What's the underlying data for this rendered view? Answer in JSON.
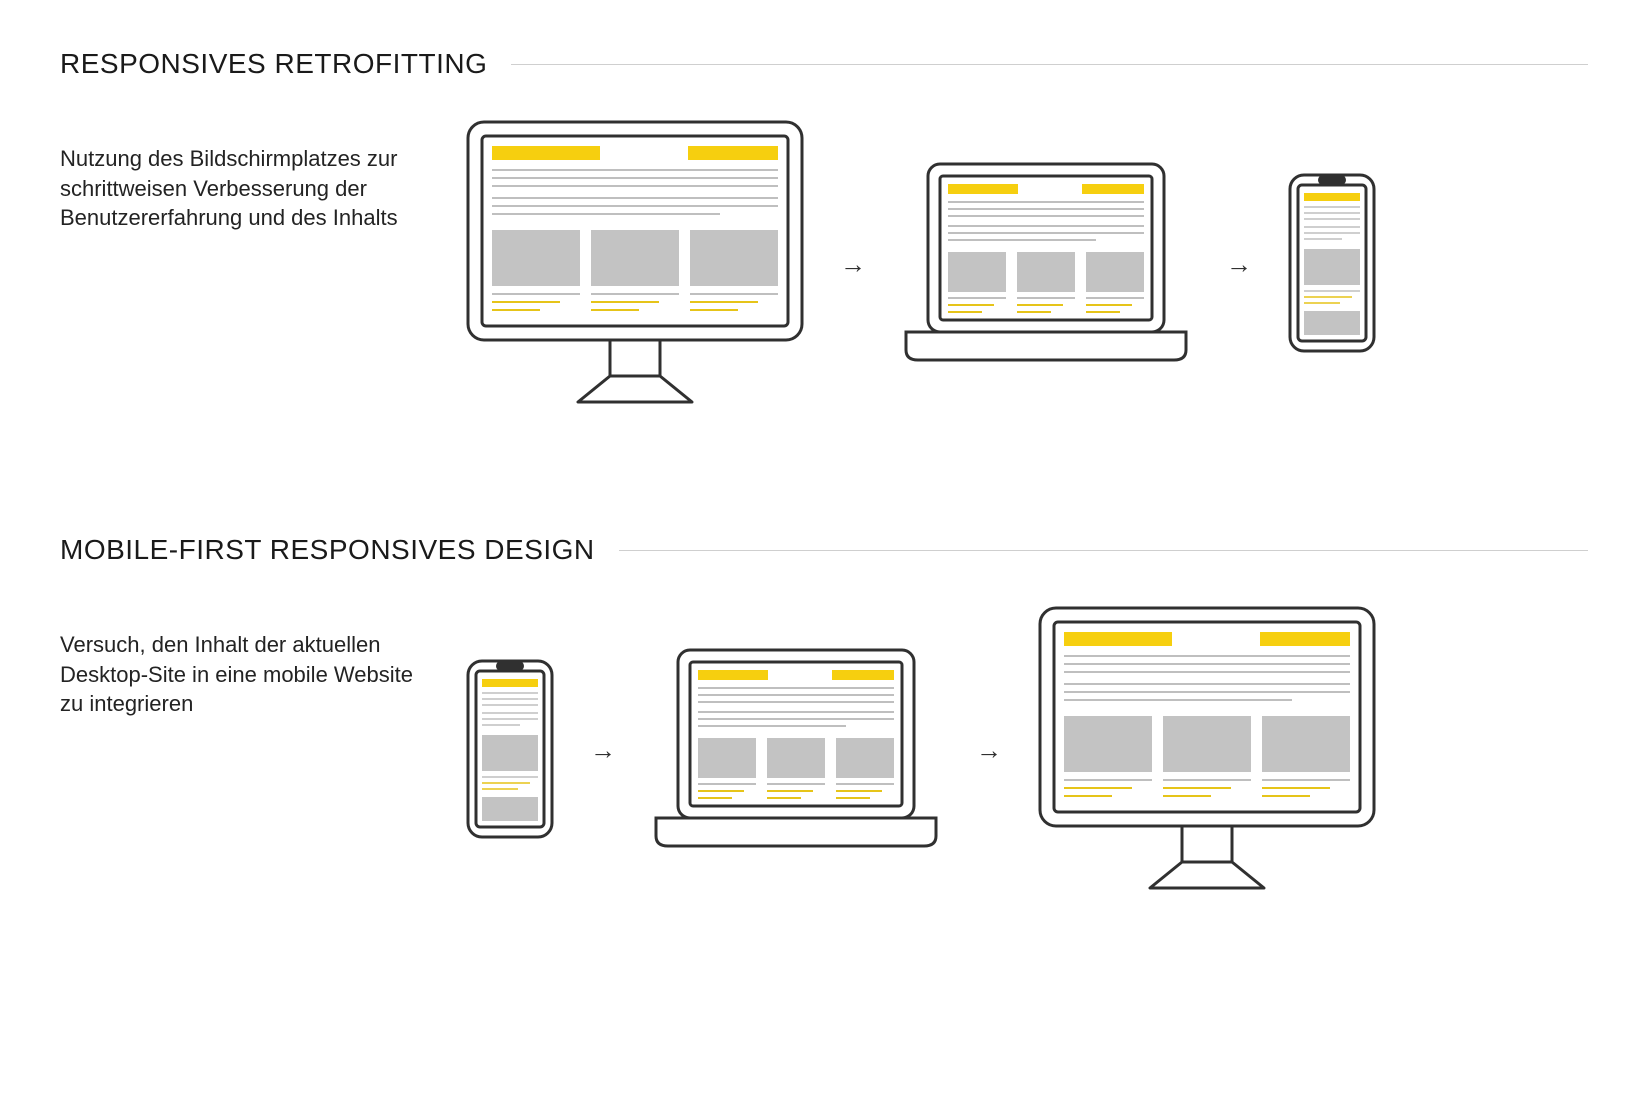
{
  "sections": {
    "retrofitting": {
      "title": "RESPONSIVES RETROFITTING",
      "description": "Nutzung des Bildschirmplatzes zur schrittweisen Verbesserung der Benutzererfahrung und des Inhalts"
    },
    "mobile_first": {
      "title": "MOBILE-FIRST RESPONSIVES DESIGN",
      "description": "Versuch, den Inhalt der aktuellen Desktop-Site in eine mobile Website zu integrieren"
    }
  },
  "arrow_glyph": "→",
  "colors": {
    "accent": "#F6CF0F",
    "stroke": "#303030",
    "text_line": "#bfbfbf",
    "block": "#c3c3c3",
    "accent_line": "#E6C419"
  }
}
